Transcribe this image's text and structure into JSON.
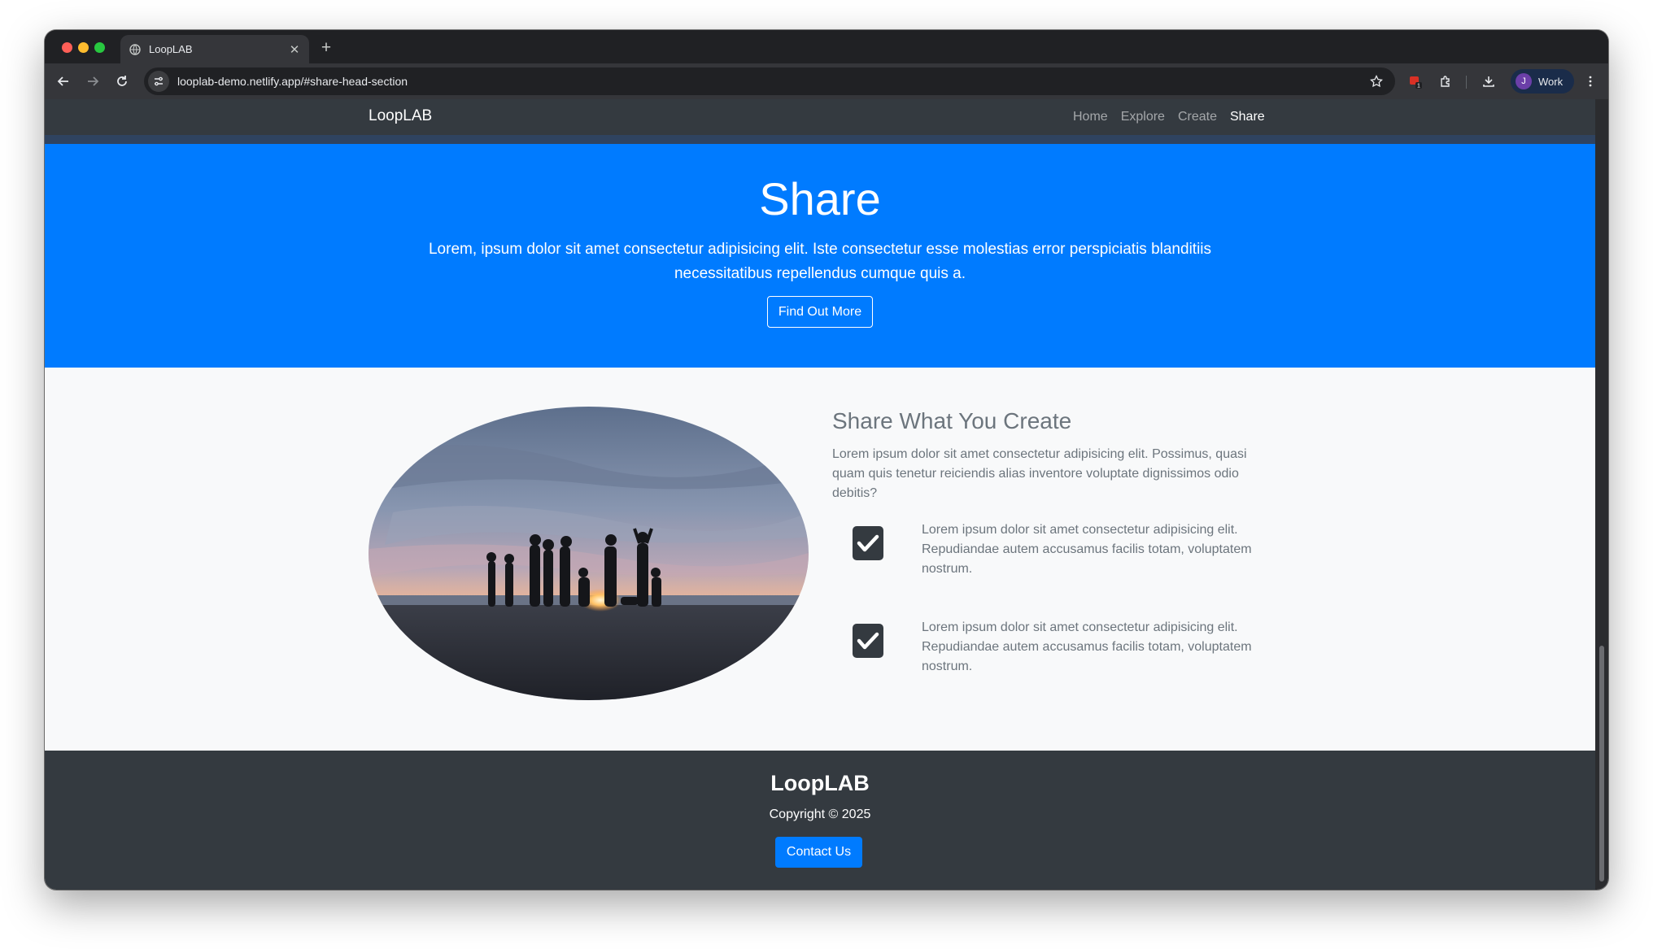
{
  "browser": {
    "tab_title": "LoopLAB",
    "url": "looplab-demo.netlify.app/#share-head-section",
    "profile_label": "Work",
    "profile_initial": "J",
    "extension_badge": "1",
    "icons": [
      "back-icon",
      "forward-icon",
      "reload-icon",
      "site-info-icon",
      "star-icon",
      "extension-icon",
      "puzzle-icon",
      "download-icon",
      "menu-icon"
    ]
  },
  "navbar": {
    "brand": "LoopLAB",
    "links": [
      {
        "label": "Home",
        "active": false
      },
      {
        "label": "Explore",
        "active": false
      },
      {
        "label": "Create",
        "active": false
      },
      {
        "label": "Share",
        "active": true
      }
    ]
  },
  "hero": {
    "title": "Share",
    "text": "Lorem, ipsum dolor sit amet consectetur adipisicing elit. Iste consectetur esse molestias error perspiciatis blanditiis necessitatibus repellendus cumque quis a.",
    "button": "Find Out More",
    "background": "#007bff"
  },
  "section": {
    "heading": "Share What You Create",
    "intro": "Lorem ipsum dolor sit amet consectetur adipisicing elit. Possimus, quasi quam quis tenetur reiciendis alias inventore voluptate dignissimos odio debitis?",
    "image": "group of people silhouetted around a beach bonfire at sunset (oval)",
    "features": [
      {
        "icon": "check-square-icon",
        "text": "Lorem ipsum dolor sit amet consectetur adipisicing elit. Repudiandae autem accusamus facilis totam, voluptatem nostrum."
      },
      {
        "icon": "check-square-icon",
        "text": "Lorem ipsum dolor sit amet consectetur adipisicing elit. Repudiandae autem accusamus facilis totam, voluptatem nostrum."
      }
    ]
  },
  "footer": {
    "brand": "LoopLAB",
    "copyright": "Copyright © 2025",
    "button": "Contact Us",
    "background": "#343a40"
  }
}
